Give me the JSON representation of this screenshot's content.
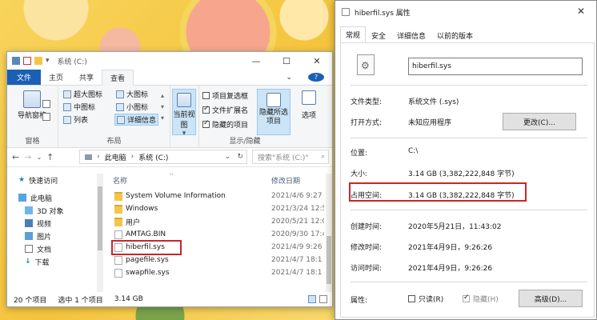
{
  "explorer": {
    "title": "系统 (C:)",
    "window_buttons": [
      "—",
      "☐",
      "✕"
    ],
    "tabs": [
      "文件",
      "主页",
      "共享",
      "查看"
    ],
    "help": "?",
    "ribbon": {
      "nav_pane": "导航窗格",
      "pane_group": "窗格",
      "layout": [
        "超大图标",
        "大图标",
        "中图标",
        "小图标",
        "列表",
        "详细信息"
      ],
      "layout_group": "布局",
      "current_view": "当前视图",
      "show_hide": {
        "item_checkbox": "项目复选框",
        "file_ext": "文件扩展名",
        "hidden_items": "隐藏的项目",
        "hide_selected": "隐藏所选项目",
        "options": "选项",
        "group": "显示/隐藏"
      }
    },
    "address": {
      "path": [
        "此电脑",
        "系统 (C:)"
      ],
      "search_placeholder": "搜索\"系统 (C:)\""
    },
    "nav": [
      "快速访问",
      "此电脑",
      "3D 对象",
      "视频",
      "图片",
      "文档",
      "下载"
    ],
    "columns": {
      "name": "名称",
      "date": "修改日期"
    },
    "files": [
      {
        "name": "System Volume Information",
        "date": "2021/4/6 9:27",
        "kind": "folder"
      },
      {
        "name": "Windows",
        "date": "2021/3/24 12:5",
        "kind": "folder"
      },
      {
        "name": "用户",
        "date": "2020/5/21 12:0",
        "kind": "folder"
      },
      {
        "name": "AMTAG.BIN",
        "date": "2020/9/30 17:4",
        "kind": "file"
      },
      {
        "name": "hiberfil.sys",
        "date": "2021/4/9 9:26",
        "kind": "sys"
      },
      {
        "name": "pagefile.sys",
        "date": "2021/4/7 18:1",
        "kind": "sys"
      },
      {
        "name": "swapfile.sys",
        "date": "2021/4/7 18:1",
        "kind": "sys"
      }
    ],
    "status": {
      "count": "20 个项目",
      "selected": "选中 1 个项目",
      "size": "3.14 GB"
    }
  },
  "props": {
    "title": "hiberfil.sys 属性",
    "close": "✕",
    "tabs": [
      "常规",
      "安全",
      "详细信息",
      "以前的版本"
    ],
    "file_name": "hiberfil.sys",
    "type_label": "文件类型:",
    "type_value": "系统文件 (.sys)",
    "open_label": "打开方式:",
    "open_value": "未知应用程序",
    "change_btn": "更改(C)...",
    "location_label": "位置:",
    "location_value": "C:\\",
    "size_label": "大小:",
    "size_value": "3.14 GB (3,382,222,848 字节)",
    "disk_label": "占用空间:",
    "disk_value": "3.14 GB (3,382,222,848 字节)",
    "created_label": "创建时间:",
    "created_value": "2020年5月21日，11:43:02",
    "modified_label": "修改时间:",
    "modified_value": "2021年4月9日，9:26:26",
    "accessed_label": "访问时间:",
    "accessed_value": "2021年4月9日，9:26:26",
    "attr_label": "属性:",
    "readonly": "只读(R)",
    "hidden": "隐藏(H)",
    "advanced_btn": "高级(D)..."
  }
}
